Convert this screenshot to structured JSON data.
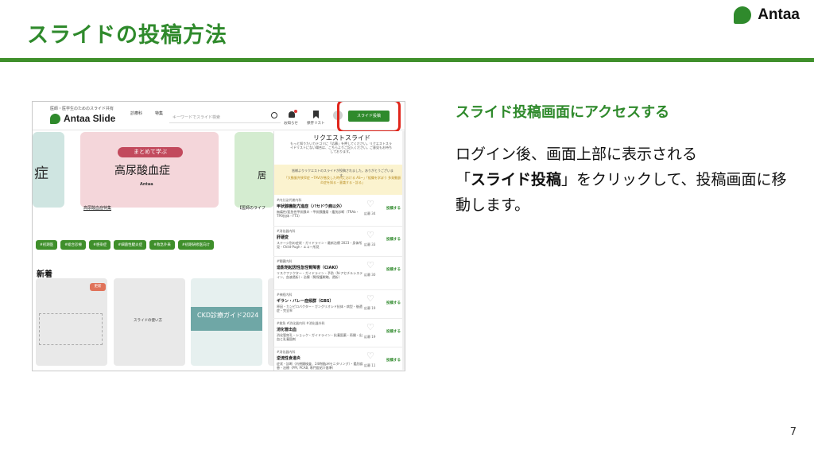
{
  "slide": {
    "title": "スライドの投稿方法",
    "brand": "Antaa",
    "page_number": "7"
  },
  "screenshot": {
    "tagline": "医師・医学生のためのスライド共有",
    "logo": "Antaa Slide",
    "nav_a": "診療科",
    "nav_b": "特集",
    "search_placeholder": "キーワードでスライド検索",
    "notice_label": "お知らせ",
    "saved_label": "保存リスト",
    "post_button": "スライド投稿",
    "hero": {
      "left_text": "症",
      "pill": "まとめて学ぶ",
      "title": "高尿酸血症",
      "brand": "Antaa",
      "right_text": "居",
      "caption_left": "高尿酸血症特集",
      "caption_right": "【医師のライフ"
    },
    "tags": [
      "#初期医",
      "#総合診療",
      "#感染症",
      "#細菌性腱炎症",
      "#救急外来",
      "#初期研修医向け"
    ],
    "new_heading": "新着",
    "new_badge": "更新",
    "card2_text": "スライドの使い方",
    "card3_text": "CKD診療ガイド2024",
    "panel": {
      "title": "リクエストスライド",
      "desc": "もっと知りたいカテゴリに「応募」を押してください。リクエストスライドリストにない場合は、こちらよりご記入ください。ご意見もお待ちしております。",
      "notice": "皆様よりリクエストのスライドが投稿されました。ありがとうございます。",
      "notice_links": "「大動脈弁狭窄症 ~TAVIが普及した時代における AS~」「組織を学ぼう 多発動脈炎症を知る・意識する・診る」",
      "requests": [
        {
          "cat": "#内分泌代謝内科",
          "name": "甲状腺機能亢進症（バセドウ病以外）",
          "desc": "無痛性/亜急性甲状腺炎・甲状腺腫瘍・鑑別診断（TRAb・TPO抗体・FT3）",
          "count": "応募 34",
          "post": "投稿する"
        },
        {
          "cat": "#消化器内科",
          "name": "肝硬変",
          "desc": "ステージ別の症状・ガイドライン・最新治療 2023・身体所見・Child-Pugh・エコー所見",
          "count": "応募 33",
          "post": "投稿する"
        },
        {
          "cat": "#腎臓内科",
          "name": "造影剤起因性急性腎障害（CIAKI）",
          "desc": "リスクファクター・ガイドライン・予防（N-アセチルシステイン、血液透析）・治療（腎保護戦略、透析）",
          "count": "応募 30",
          "post": "投稿する"
        },
        {
          "cat": "#神経内科",
          "name": "ギラン・バレー症候群（GBS）",
          "desc": "原因・カンピロバクター・ガングリオシド抗体・病型・後遺症・完全率",
          "count": "応募 19",
          "post": "投稿する"
        },
        {
          "cat": "#救急 #消化器内科 #消化器外科",
          "name": "消化管出血",
          "desc": "消化管穿孔・ショック・ガイドライン・抗凝固薬・再開・出血と乳凝固剤",
          "count": "応募 19",
          "post": "投稿する"
        },
        {
          "cat": "#消化器内科",
          "name": "逆流性食道炎",
          "desc": "症状・診断（内視鏡検査、24時間pHモニタリング）・鑑別疾患・治療（PPI, PCAB, 専門医紹介基準）",
          "count": "応募 11",
          "post": "投稿する"
        }
      ]
    }
  },
  "explanation": {
    "heading": "スライド投稿画面にアクセスする",
    "line1": "ログイン後、画面上部に表示される",
    "line2_pre": "「",
    "line2_bold": "スライド投稿",
    "line2_post": "」をクリックして、投稿画面に移",
    "line3": "動します。"
  }
}
